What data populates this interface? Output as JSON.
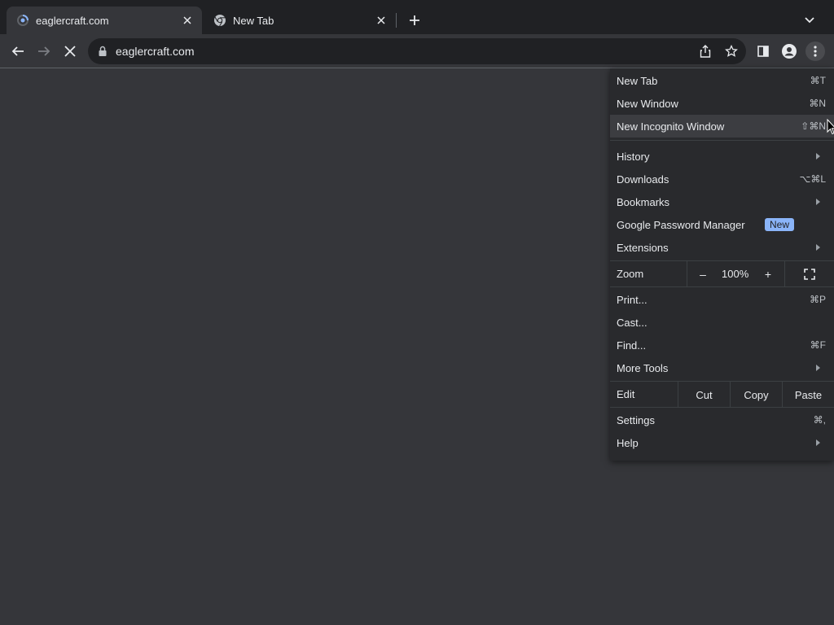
{
  "tabs": [
    {
      "title": "eaglercraft.com",
      "active": true,
      "icon": "loading-spinner-icon"
    },
    {
      "title": "New Tab",
      "active": false,
      "icon": "chrome-logo-icon"
    }
  ],
  "toolbar": {
    "url": "eaglercraft.com",
    "icons": [
      "back-arrow-icon",
      "forward-arrow-icon",
      "stop-loading-icon",
      "lock-icon",
      "share-icon",
      "bookmark-star-icon",
      "side-panel-icon",
      "profile-icon",
      "more-menu-icon"
    ]
  },
  "menu": {
    "new_tab": {
      "label": "New Tab",
      "shortcut": "⌘T"
    },
    "new_window": {
      "label": "New Window",
      "shortcut": "⌘N"
    },
    "new_incognito": {
      "label": "New Incognito Window",
      "shortcut": "⇧⌘N"
    },
    "history": {
      "label": "History"
    },
    "downloads": {
      "label": "Downloads",
      "shortcut": "⌥⌘L"
    },
    "bookmarks": {
      "label": "Bookmarks"
    },
    "password_manager": {
      "label": "Google Password Manager",
      "badge": "New"
    },
    "extensions": {
      "label": "Extensions"
    },
    "zoom": {
      "label": "Zoom",
      "minus": "–",
      "value": "100%",
      "plus": "+"
    },
    "print": {
      "label": "Print...",
      "shortcut": "⌘P"
    },
    "cast": {
      "label": "Cast..."
    },
    "find": {
      "label": "Find...",
      "shortcut": "⌘F"
    },
    "more_tools": {
      "label": "More Tools"
    },
    "edit": {
      "label": "Edit",
      "cut": "Cut",
      "copy": "Copy",
      "paste": "Paste"
    },
    "settings": {
      "label": "Settings",
      "shortcut": "⌘,"
    },
    "help": {
      "label": "Help"
    }
  },
  "colors": {
    "tab_strip_bg": "#202124",
    "toolbar_bg": "#35363a",
    "menu_bg": "#292a2d",
    "badge_bg": "#8ab4f8"
  }
}
